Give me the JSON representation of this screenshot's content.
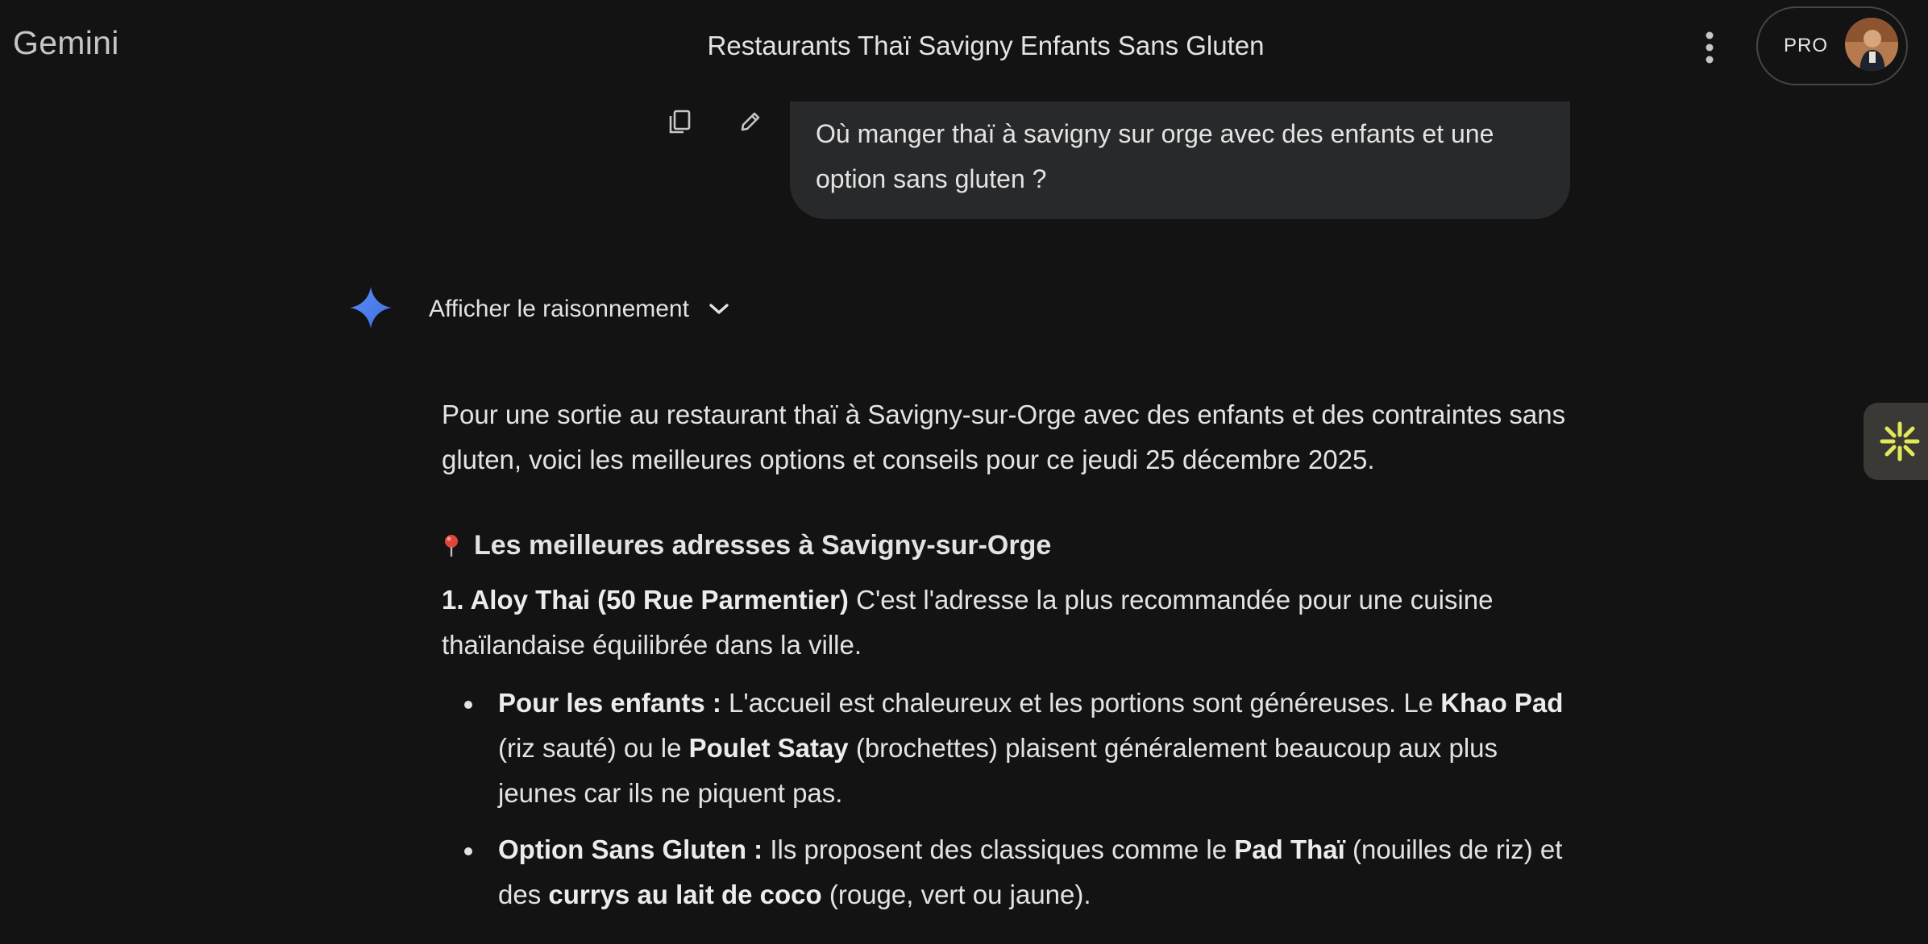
{
  "header": {
    "app_name": "Gemini",
    "title": "Restaurants Thaï Savigny Enfants Sans Gluten",
    "pro_label": "PRO"
  },
  "user_message": {
    "text": "Où manger thaï à savigny sur orge avec des enfants et une option sans gluten ?"
  },
  "response": {
    "reasoning_label": "Afficher le raisonnement",
    "intro": "Pour une sortie au restaurant thaï à Savigny-sur-Orge avec des enfants et des contraintes sans gluten, voici les meilleures options et conseils pour ce jeudi 25 décembre 2025.",
    "heading": "Les meilleures adresses à Savigny-sur-Orge",
    "item1_title": "1. Aloy Thai (50 Rue Parmentier)",
    "item1_text": " C'est l'adresse la plus recommandée pour une cuisine thaïlandaise équilibrée dans la ville.",
    "bullet1": {
      "label": "Pour les enfants :",
      "t1": " L'accueil est chaleureux et les portions sont généreuses. Le ",
      "b1": "Khao Pad",
      "t2": " (riz sauté) ou le ",
      "b2": "Poulet Satay",
      "t3": " (brochettes) plaisent généralement beaucoup aux plus jeunes car ils ne piquent pas."
    },
    "bullet2": {
      "label": "Option Sans Gluten :",
      "t1": " Ils proposent des classiques comme le ",
      "b1": "Pad Thaï",
      "t2": " (nouilles de riz) et des ",
      "b2": "currys au lait de coco",
      "t3": " (rouge, vert ou jaune)."
    }
  },
  "icons": {
    "copy": "copy-icon",
    "edit": "pencil-icon",
    "more": "more-vert-icon",
    "gemini": "gemini-sparkle-icon",
    "chevron": "chevron-down-icon",
    "pin": "map-pin-icon",
    "side": "sparkle-burst-icon"
  },
  "colors": {
    "background": "#131314",
    "bubble": "#28292b",
    "gemini_star": "#4a7ff2",
    "side_accent": "#e2e85a"
  }
}
